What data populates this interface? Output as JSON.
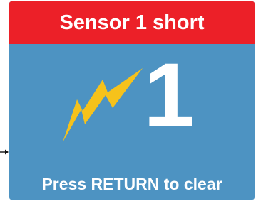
{
  "alert": {
    "title": "Sensor 1 short",
    "sensor_number": "1",
    "instruction": "Press RETURN to clear",
    "icon": "lightning-bolt-icon"
  },
  "colors": {
    "header_background": "#ec2028",
    "screen_background": "#4d93c2",
    "bolt_fill": "#f6c21b",
    "text": "#ffffff"
  }
}
